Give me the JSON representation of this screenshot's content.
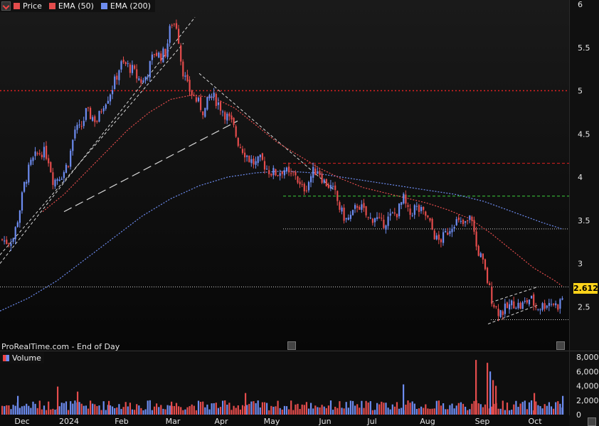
{
  "legend": {
    "items": [
      {
        "label": "Price",
        "color": "#e44c4c"
      },
      {
        "label": "EMA (50)",
        "color": "#e44c4c"
      },
      {
        "label": "EMA (200)",
        "color": "#6d8cf0"
      }
    ]
  },
  "footer": "ProRealTime.com - End of Day",
  "volume_label": "Volume",
  "last_price": "2.612",
  "colors": {
    "up": "#6d8cf0",
    "down": "#e44c4c",
    "ema50": "#e44c4c",
    "ema200": "#6d8cf0",
    "level_red": "#e02020",
    "level_green": "#3ccf3c"
  },
  "chart_data": {
    "type": "candlestick",
    "x_ticks": [
      "Dec",
      "2024",
      "Feb",
      "Mar",
      "Apr",
      "May",
      "Jun",
      "Jul",
      "Aug",
      "Sep",
      "Oct"
    ],
    "y_ticks": [
      "6",
      "5.5",
      "5",
      "4.5",
      "4",
      "3.5",
      "3",
      "2.5"
    ],
    "ylim": [
      2.0,
      6.05
    ],
    "volume_ticks": [
      "8,000k",
      "6,000k",
      "4,000k",
      "2,000k",
      "0"
    ],
    "volume_ylim": [
      0,
      8500
    ],
    "price_path": [
      [
        0,
        3.28
      ],
      [
        10,
        3.25
      ],
      [
        18,
        3.3
      ],
      [
        26,
        3.6
      ],
      [
        34,
        3.95
      ],
      [
        42,
        4.15
      ],
      [
        50,
        4.25
      ],
      [
        58,
        4.3
      ],
      [
        66,
        4.25
      ],
      [
        74,
        3.95
      ],
      [
        80,
        4.0
      ],
      [
        88,
        4.05
      ],
      [
        96,
        4.2
      ],
      [
        104,
        4.55
      ],
      [
        112,
        4.55
      ],
      [
        120,
        4.75
      ],
      [
        128,
        4.7
      ],
      [
        136,
        4.65
      ],
      [
        144,
        4.85
      ],
      [
        152,
        4.95
      ],
      [
        160,
        5.1
      ],
      [
        168,
        5.3
      ],
      [
        176,
        5.3
      ],
      [
        184,
        5.25
      ],
      [
        192,
        5.15
      ],
      [
        200,
        5.1
      ],
      [
        208,
        5.25
      ],
      [
        216,
        5.45
      ],
      [
        224,
        5.4
      ],
      [
        232,
        5.45
      ],
      [
        240,
        5.8
      ],
      [
        248,
        5.75
      ],
      [
        254,
        5.3
      ],
      [
        262,
        5.05
      ],
      [
        270,
        4.95
      ],
      [
        278,
        4.85
      ],
      [
        286,
        4.75
      ],
      [
        294,
        4.95
      ],
      [
        302,
        4.9
      ],
      [
        310,
        4.8
      ],
      [
        318,
        4.7
      ],
      [
        326,
        4.6
      ],
      [
        334,
        4.4
      ],
      [
        342,
        4.3
      ],
      [
        350,
        4.2
      ],
      [
        358,
        4.15
      ],
      [
        366,
        4.2
      ],
      [
        374,
        4.1
      ],
      [
        382,
        4.05
      ],
      [
        390,
        4.05
      ],
      [
        398,
        4.1
      ],
      [
        406,
        4.0
      ],
      [
        414,
        4.05
      ],
      [
        422,
        3.85
      ],
      [
        430,
        3.9
      ],
      [
        438,
        4.05
      ],
      [
        446,
        4.1
      ],
      [
        454,
        3.95
      ],
      [
        462,
        3.9
      ],
      [
        470,
        3.8
      ],
      [
        478,
        3.6
      ],
      [
        486,
        3.5
      ],
      [
        494,
        3.55
      ],
      [
        502,
        3.7
      ],
      [
        510,
        3.6
      ],
      [
        518,
        3.5
      ],
      [
        526,
        3.55
      ],
      [
        534,
        3.45
      ],
      [
        542,
        3.5
      ],
      [
        550,
        3.55
      ],
      [
        558,
        3.6
      ],
      [
        566,
        3.75
      ],
      [
        574,
        3.55
      ],
      [
        582,
        3.65
      ],
      [
        590,
        3.6
      ],
      [
        598,
        3.55
      ],
      [
        606,
        3.4
      ],
      [
        614,
        3.25
      ],
      [
        622,
        3.3
      ],
      [
        630,
        3.4
      ],
      [
        638,
        3.5
      ],
      [
        646,
        3.45
      ],
      [
        654,
        3.45
      ],
      [
        662,
        3.55
      ],
      [
        668,
        3.2
      ],
      [
        676,
        3.05
      ],
      [
        684,
        2.8
      ],
      [
        690,
        2.6
      ],
      [
        698,
        2.45
      ],
      [
        706,
        2.45
      ],
      [
        714,
        2.5
      ],
      [
        722,
        2.55
      ],
      [
        730,
        2.5
      ],
      [
        738,
        2.55
      ],
      [
        744,
        2.6
      ],
      [
        752,
        2.5
      ],
      [
        760,
        2.5
      ],
      [
        768,
        2.55
      ],
      [
        776,
        2.55
      ],
      [
        782,
        2.5
      ],
      [
        790,
        2.61
      ]
    ],
    "ema50_path": [
      [
        60,
        3.6
      ],
      [
        90,
        3.8
      ],
      [
        120,
        4.05
      ],
      [
        150,
        4.3
      ],
      [
        180,
        4.55
      ],
      [
        210,
        4.75
      ],
      [
        240,
        4.9
      ],
      [
        270,
        4.95
      ],
      [
        300,
        4.92
      ],
      [
        330,
        4.8
      ],
      [
        360,
        4.6
      ],
      [
        390,
        4.4
      ],
      [
        420,
        4.25
      ],
      [
        450,
        4.1
      ],
      [
        480,
        3.98
      ],
      [
        510,
        3.88
      ],
      [
        540,
        3.82
      ],
      [
        570,
        3.76
      ],
      [
        600,
        3.7
      ],
      [
        630,
        3.62
      ],
      [
        660,
        3.52
      ],
      [
        690,
        3.35
      ],
      [
        720,
        3.15
      ],
      [
        750,
        2.95
      ],
      [
        780,
        2.8
      ],
      [
        790,
        2.74
      ]
    ],
    "ema200_path": [
      [
        0,
        2.45
      ],
      [
        40,
        2.6
      ],
      [
        80,
        2.8
      ],
      [
        120,
        3.05
      ],
      [
        160,
        3.3
      ],
      [
        200,
        3.55
      ],
      [
        240,
        3.75
      ],
      [
        280,
        3.9
      ],
      [
        320,
        4.0
      ],
      [
        360,
        4.05
      ],
      [
        400,
        4.07
      ],
      [
        440,
        4.05
      ],
      [
        480,
        4.0
      ],
      [
        520,
        3.95
      ],
      [
        560,
        3.9
      ],
      [
        600,
        3.85
      ],
      [
        640,
        3.8
      ],
      [
        680,
        3.72
      ],
      [
        720,
        3.6
      ],
      [
        760,
        3.48
      ],
      [
        790,
        3.4
      ]
    ],
    "levels": [
      {
        "y": 5.0,
        "style": "red-dotted",
        "x0": 0,
        "x1": 800
      },
      {
        "y": 4.16,
        "style": "red-dashed",
        "x0": 398,
        "x1": 800
      },
      {
        "y": 3.78,
        "style": "green-dashed",
        "x0": 398,
        "x1": 800
      },
      {
        "y": 3.4,
        "style": "white-dotted",
        "x0": 398,
        "x1": 800
      },
      {
        "y": 2.73,
        "style": "white-dotted",
        "x0": 0,
        "x1": 800
      },
      {
        "y": 2.35,
        "style": "white-dotted",
        "x0": 690,
        "x1": 800
      }
    ],
    "trendlines": [
      {
        "from": [
          0,
          3.0
        ],
        "to": [
          274,
          5.85
        ],
        "style": "white-dashed"
      },
      {
        "from": [
          0,
          3.1
        ],
        "to": [
          258,
          5.55
        ],
        "style": "white-dashed"
      },
      {
        "from": [
          90,
          3.6
        ],
        "to": [
          334,
          4.65
        ],
        "style": "white-longdash"
      },
      {
        "from": [
          280,
          5.2
        ],
        "to": [
          470,
          3.85
        ],
        "style": "white-dashed"
      },
      {
        "from": [
          686,
          2.3
        ],
        "to": [
          756,
          2.52
        ],
        "style": "white-dashed"
      },
      {
        "from": [
          690,
          2.55
        ],
        "to": [
          756,
          2.73
        ],
        "style": "white-dashed"
      }
    ],
    "volume_spikes": [
      [
        668,
        7600
      ],
      [
        684,
        7200
      ],
      [
        688,
        6000
      ],
      [
        692,
        4800
      ],
      [
        696,
        4000
      ],
      [
        566,
        4200
      ],
      [
        80,
        3900
      ],
      [
        108,
        3200
      ],
      [
        24,
        2600
      ],
      [
        344,
        3000
      ],
      [
        750,
        3000
      ],
      [
        790,
        2600
      ],
      [
        152,
        1900
      ],
      [
        240,
        1800
      ]
    ]
  }
}
